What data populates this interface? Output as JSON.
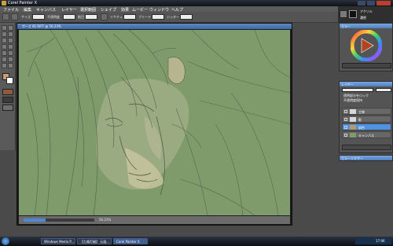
{
  "window": {
    "title": "Corel Painter X"
  },
  "menu": {
    "items": [
      "ファイル",
      "編集",
      "キャンバス",
      "レイヤー",
      "選択範囲",
      "シェイプ",
      "効果",
      "ムービー",
      "ウィンドウ",
      "ヘルプ"
    ]
  },
  "commandbar": {
    "size_label": "サイズ",
    "opacity_label": "不透明度",
    "grain_label": "紙目",
    "resat_label": "リサチュ",
    "bleed_label": "ブリード",
    "jitter_label": "ジッター",
    "size_value": "8.0",
    "opacity_value": "43%",
    "grain_value": "100%",
    "jitter_value": "0.00"
  },
  "brush": {
    "category": "アクリル",
    "variant": "濃密"
  },
  "document": {
    "title": "ポーズ 81 RIFF @ 56.23%",
    "zoom_value": "56.23%"
  },
  "color_panel": {
    "title": "カラー"
  },
  "layers_panel": {
    "title": "レイヤー",
    "composite_label": "通常",
    "opacity_value": "100",
    "option1": "透明部分をロック",
    "option2": "不透明度保持",
    "layers": [
      {
        "name": "主線"
      },
      {
        "name": "影"
      },
      {
        "name": "肌色"
      },
      {
        "name": "キャンバス"
      }
    ]
  },
  "mixer_panel": {
    "title": "カラーミキサー"
  },
  "taskbar": {
    "items": [
      "Windows Media P...",
      "【九條灯磁】 元画...",
      "Corel Painter X"
    ],
    "clock": "17:06"
  },
  "colors": {
    "canvas_bg": "#7f9b6b",
    "selection": "#4f92e2"
  }
}
